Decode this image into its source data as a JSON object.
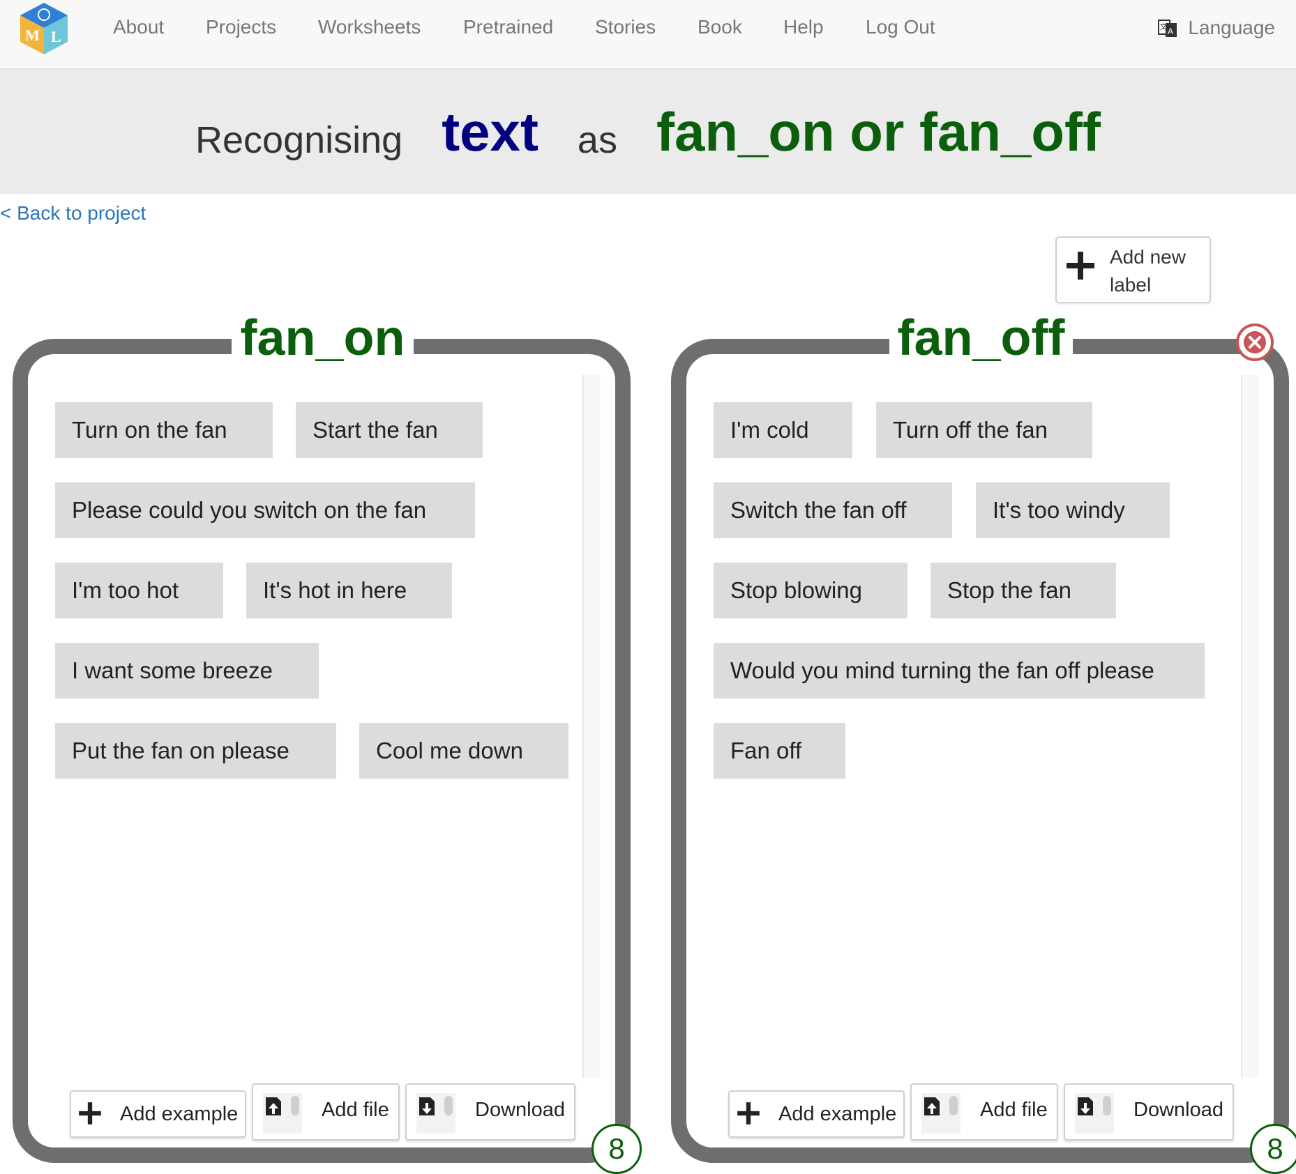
{
  "navbar": {
    "items": [
      "About",
      "Projects",
      "Worksheets",
      "Pretrained",
      "Stories",
      "Book",
      "Help",
      "Log Out"
    ],
    "language": "Language",
    "logo_letters": [
      "M",
      "L"
    ]
  },
  "banner": {
    "prefix": "Recognising",
    "type": "text",
    "middle": "as",
    "labels": "fan_on or fan_off"
  },
  "back_link": "< Back to project",
  "add_label_button": "Add new label",
  "labels": [
    {
      "name": "fan_on",
      "count": "8",
      "examples": [
        "Turn on the fan",
        "Start the fan",
        "Please could you switch on the fan",
        "I'm too hot",
        "It's hot in here",
        "I want some breeze",
        "Put the fan on please",
        "Cool me down"
      ],
      "buttons": {
        "add_example": "Add example",
        "add_file": "Add file",
        "download": "Download"
      }
    },
    {
      "name": "fan_off",
      "count": "8",
      "examples": [
        "I'm cold",
        "Turn off the fan",
        "Switch the fan off",
        "It's too windy",
        "Stop blowing",
        "Stop the fan",
        "Would you mind turning the fan off please",
        "Fan off"
      ],
      "buttons": {
        "add_example": "Add example",
        "add_file": "Add file",
        "download": "Download"
      }
    }
  ],
  "colors": {
    "label_green": "#0b5e0b",
    "type_blue": "#000080",
    "link_blue": "#2a74b8",
    "frame_gray": "#6e6e6e",
    "chip_gray": "#dcdcdc",
    "delete_red": "#c9545a"
  },
  "icons": [
    "logo-cube-icon",
    "language-icon",
    "plus-icon",
    "upload-file-icon",
    "download-file-icon",
    "delete-circle-x-icon"
  ]
}
